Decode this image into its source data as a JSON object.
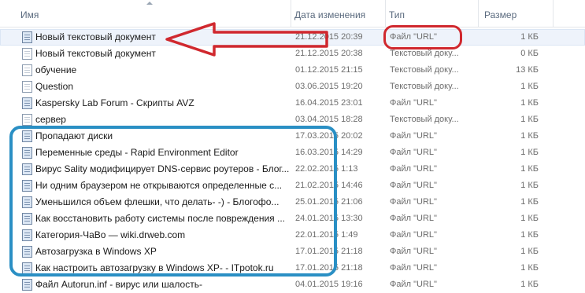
{
  "columns": {
    "name": "Имя",
    "date": "Дата изменения",
    "type": "Тип",
    "size": "Размер"
  },
  "files": [
    {
      "name": "Новый текстовый документ",
      "date": "21.12.2015 20:39",
      "type": "Файл \"URL\"",
      "size": "1 КБ",
      "icon": "url-file-icon",
      "selected": true
    },
    {
      "name": "Новый текстовый документ",
      "date": "21.12.2015 20:38",
      "type": "Текстовый доку...",
      "size": "0 КБ",
      "icon": "text-file-icon"
    },
    {
      "name": "обучение",
      "date": "01.12.2015 21:15",
      "type": "Текстовый доку...",
      "size": "13 КБ",
      "icon": "text-file-icon"
    },
    {
      "name": "Question",
      "date": "03.06.2015 19:20",
      "type": "Текстовый доку...",
      "size": "1 КБ",
      "icon": "text-file-icon"
    },
    {
      "name": "Kaspersky Lab Forum - Скрипты AVZ",
      "date": "16.04.2015 23:01",
      "type": "Файл \"URL\"",
      "size": "1 КБ",
      "icon": "url-file-icon"
    },
    {
      "name": "сервер",
      "date": "03.04.2015 18:28",
      "type": "Текстовый доку...",
      "size": "1 КБ",
      "icon": "text-file-icon"
    },
    {
      "name": "Пропадают диски",
      "date": "17.03.2015 20:02",
      "type": "Файл \"URL\"",
      "size": "1 КБ",
      "icon": "url-file-icon"
    },
    {
      "name": "Переменные среды - Rapid Environment Editor",
      "date": "16.03.2015 14:29",
      "type": "Файл \"URL\"",
      "size": "1 КБ",
      "icon": "url-file-icon"
    },
    {
      "name": "Вирус Sality модифицирует DNS-сервис роутеров - Блог...",
      "date": "22.02.2015 1:13",
      "type": "Файл \"URL\"",
      "size": "1 КБ",
      "icon": "url-file-icon"
    },
    {
      "name": "Ни одним браузером не открываются определенные с...",
      "date": "21.02.2015 14:46",
      "type": "Файл \"URL\"",
      "size": "1 КБ",
      "icon": "url-file-icon"
    },
    {
      "name": "Уменьшился объем флешки, что делать- -) - Блогофо...",
      "date": "25.01.2015 21:06",
      "type": "Файл \"URL\"",
      "size": "1 КБ",
      "icon": "url-file-icon"
    },
    {
      "name": "Как восстановить работу системы после повреждения ...",
      "date": "24.01.2015 13:30",
      "type": "Файл \"URL\"",
      "size": "1 КБ",
      "icon": "url-file-icon"
    },
    {
      "name": "Категория-ЧаВо — wiki.drweb.com",
      "date": "22.01.2015 1:49",
      "type": "Файл \"URL\"",
      "size": "1 КБ",
      "icon": "url-file-icon"
    },
    {
      "name": "Автозагрузка в Windows XP",
      "date": "17.01.2015 21:18",
      "type": "Файл \"URL\"",
      "size": "1 КБ",
      "icon": "url-file-icon"
    },
    {
      "name": "Как настроить автозагрузку в Windows XP- - ITpotok.ru",
      "date": "17.01.2015 21:18",
      "type": "Файл \"URL\"",
      "size": "1 КБ",
      "icon": "url-file-icon"
    },
    {
      "name": "Файл Autorun.inf - вирус или шалость-",
      "date": "04.01.2015 19:16",
      "type": "Файл \"URL\"",
      "size": "1 КБ",
      "icon": "url-file-icon"
    }
  ],
  "annotations": {
    "arrow_color": "#d0282e",
    "red_box_color": "#d0282e",
    "blue_box_color": "#2a8fc4"
  }
}
